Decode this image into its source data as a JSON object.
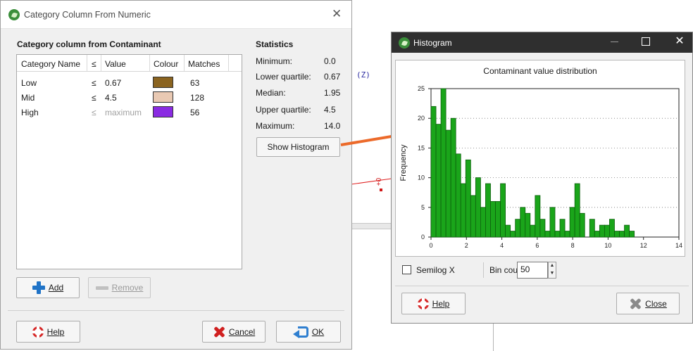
{
  "category_dialog": {
    "title": "Category Column From Numeric",
    "section_heading": "Category column from Contaminant",
    "table": {
      "columns": [
        "Category Name",
        "≤",
        "Value",
        "Colour",
        "Matches"
      ],
      "rows": [
        {
          "name": "Low",
          "le": "≤",
          "value": "0.67",
          "colour": "#8b6420",
          "matches": "63"
        },
        {
          "name": "Mid",
          "le": "≤",
          "value": "4.5",
          "colour": "#e9c9b3",
          "matches": "128"
        },
        {
          "name": "High",
          "le": "≤",
          "value": "maximum",
          "colour": "#8a2be2",
          "matches": "56"
        }
      ]
    },
    "buttons": {
      "add": "Add",
      "remove": "Remove",
      "help": "Help",
      "cancel": "Cancel",
      "ok": "OK"
    },
    "statistics": {
      "heading": "Statistics",
      "items": [
        {
          "label": "Minimum:",
          "value": "0.0"
        },
        {
          "label": "Lower quartile:",
          "value": "0.67"
        },
        {
          "label": "Median:",
          "value": "1.95"
        },
        {
          "label": "Upper quartile:",
          "value": "4.5"
        },
        {
          "label": "Maximum:",
          "value": "14.0"
        }
      ],
      "show_histogram": "Show Histogram"
    }
  },
  "background": {
    "axis_label": "(Z)",
    "marker_label": "+0"
  },
  "histogram_window": {
    "title": "Histogram",
    "semilog_label": "Semilog X",
    "semilog_checked": false,
    "bin_count_label": "Bin count:",
    "bin_count_value": "50",
    "buttons": {
      "help": "Help",
      "close": "Close"
    }
  },
  "chart_data": {
    "type": "bar",
    "title": "Contaminant value distribution",
    "xlabel": "",
    "ylabel": "Frequency",
    "xlim": [
      0,
      14
    ],
    "ylim": [
      0,
      25
    ],
    "x_ticks": [
      0,
      2,
      4,
      6,
      8,
      10,
      12,
      14
    ],
    "y_ticks": [
      0,
      5,
      10,
      15,
      20,
      25
    ],
    "grid": "horizontal dotted",
    "bar_color": "#1aa51a",
    "bin_width": 0.28,
    "bin_start": 0,
    "values": [
      22,
      19,
      25,
      18,
      20,
      14,
      9,
      13,
      7,
      10,
      5,
      9,
      6,
      6,
      9,
      2,
      1,
      3,
      5,
      4,
      2,
      7,
      3,
      1,
      5,
      1,
      3,
      1,
      5,
      9,
      4,
      0,
      3,
      1,
      2,
      2,
      3,
      1,
      1,
      2,
      1,
      0,
      0,
      0,
      0,
      0,
      0,
      0,
      0,
      0
    ]
  }
}
